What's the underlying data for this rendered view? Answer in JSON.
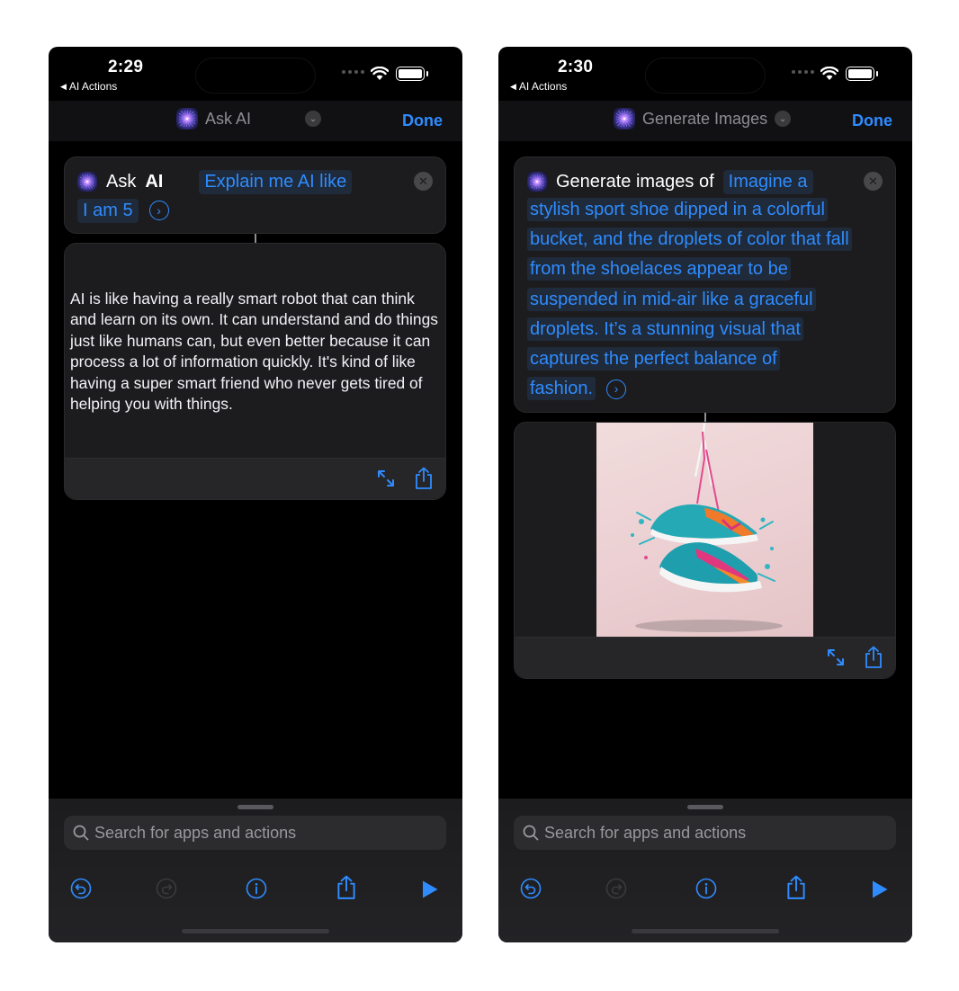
{
  "left": {
    "status": {
      "time": "2:29",
      "back_label": "AI Actions"
    },
    "nav": {
      "title": "Ask AI",
      "done_label": "Done"
    },
    "action": {
      "verb": "Ask",
      "object": "AI",
      "prompt_line1": "Explain me AI like",
      "prompt_line2": "I am 5"
    },
    "result": {
      "text": "AI is like having a really smart robot that can think and learn on its own. It can understand and do things just like humans can, but even better because it can process a lot of information quickly. It's kind of like having a super smart friend who never gets tired of helping you with things."
    },
    "search": {
      "placeholder": "Search for apps and actions"
    }
  },
  "right": {
    "status": {
      "time": "2:30",
      "back_label": "AI Actions"
    },
    "nav": {
      "title": "Generate Images",
      "done_label": "Done"
    },
    "action": {
      "verb": "Generate images of",
      "prompt_lines": [
        "Imagine a",
        "stylish sport shoe dipped in a colorful",
        "bucket, and the droplets of color that fall",
        "from the shoelaces appear to be",
        "suspended in mid-air like a graceful",
        "droplets. It’s a stunning visual that",
        "captures the perfect balance of",
        "fashion."
      ]
    },
    "search": {
      "placeholder": "Search for apps and actions"
    }
  },
  "colors": {
    "accent": "#2f8cff",
    "background": "#000000",
    "card": "#1c1c1e"
  },
  "icons": [
    "app-icon",
    "chevron-down-icon",
    "close-icon",
    "chevron-right-circle-icon",
    "expand-icon",
    "share-icon",
    "search-icon",
    "undo-icon",
    "redo-icon",
    "info-icon",
    "play-icon",
    "wifi-icon",
    "battery-icon"
  ]
}
